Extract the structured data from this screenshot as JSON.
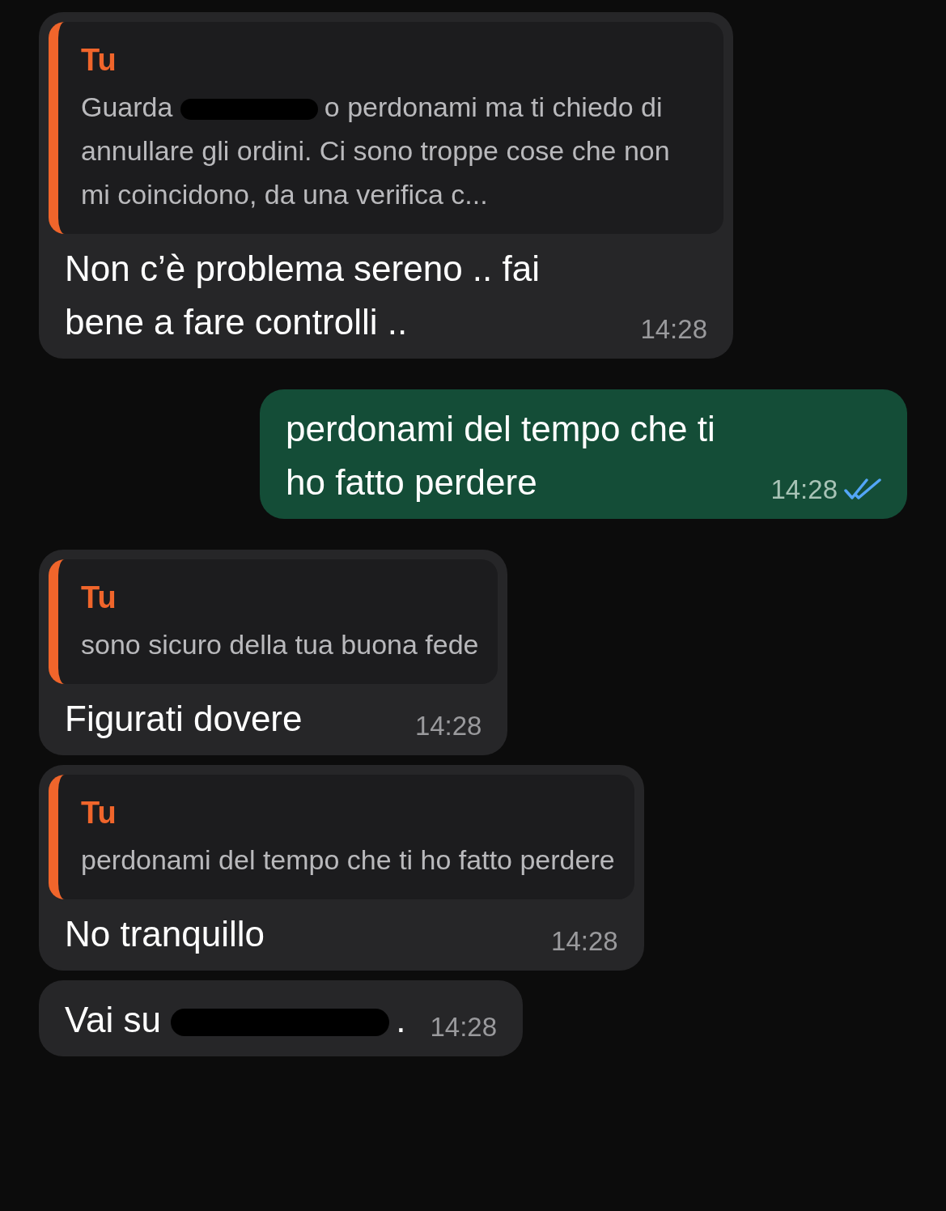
{
  "messages": [
    {
      "outgoing": false,
      "quote": {
        "author": "Tu",
        "parts": [
          {
            "kind": "text",
            "text": "Guarda"
          },
          {
            "kind": "redacted"
          },
          {
            "kind": "text",
            "text": "o perdonami ma ti chiedo di annullare gli ordini. Ci sono troppe cose che non mi coincidono, da una verifica c..."
          }
        ]
      },
      "parts": [
        {
          "kind": "text",
          "text": "Non c’è problema sereno .. fai bene a fare controlli .."
        }
      ],
      "time": "14:28"
    },
    {
      "outgoing": true,
      "parts": [
        {
          "kind": "text",
          "text": "perdonami del tempo che ti ho fatto perdere"
        }
      ],
      "time": "14:28",
      "read": true
    },
    {
      "outgoing": false,
      "quote": {
        "author": "Tu",
        "parts": [
          {
            "kind": "text",
            "text": "sono sicuro della tua buona fede"
          }
        ]
      },
      "parts": [
        {
          "kind": "text",
          "text": "Figurati dovere"
        }
      ],
      "time": "14:28"
    },
    {
      "outgoing": false,
      "quote": {
        "author": "Tu",
        "parts": [
          {
            "kind": "text",
            "text": "perdonami del tempo che ti ho fatto perdere"
          }
        ]
      },
      "parts": [
        {
          "kind": "text",
          "text": "No tranquillo"
        }
      ],
      "time": "14:28"
    },
    {
      "outgoing": false,
      "parts": [
        {
          "kind": "text",
          "text": "Vai su"
        },
        {
          "kind": "redacted"
        },
        {
          "kind": "text",
          "text": "."
        }
      ],
      "time": "14:28"
    }
  ]
}
